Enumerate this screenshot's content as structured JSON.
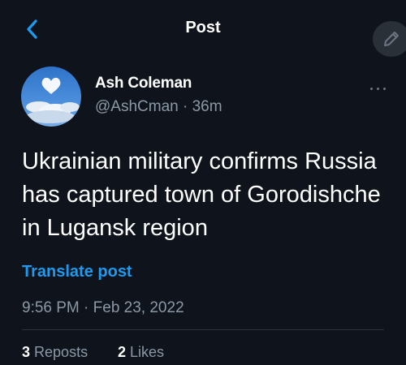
{
  "header": {
    "title": "Post",
    "back_icon": "chevron-left-icon",
    "compose_icon": "pencil-icon"
  },
  "author": {
    "display_name": "Ash Coleman",
    "handle": "@AshCman",
    "separator": "·",
    "relative_time": "36m",
    "more_icon": "more-horizontal-icon"
  },
  "post": {
    "text": "Ukrainian military confirms Russia has captured town of Gorodishche in Lugansk region",
    "translate_label": "Translate post",
    "time": "9:56 PM",
    "separator": "·",
    "date": "Feb 23, 2022"
  },
  "stats": {
    "reposts_count": "3",
    "reposts_label": "Reposts",
    "likes_count": "2",
    "likes_label": "Likes"
  },
  "colors": {
    "background": "#0f141c",
    "accent": "#1d9bf0",
    "secondary_text": "#8b98a5",
    "divider": "#2f3336"
  }
}
